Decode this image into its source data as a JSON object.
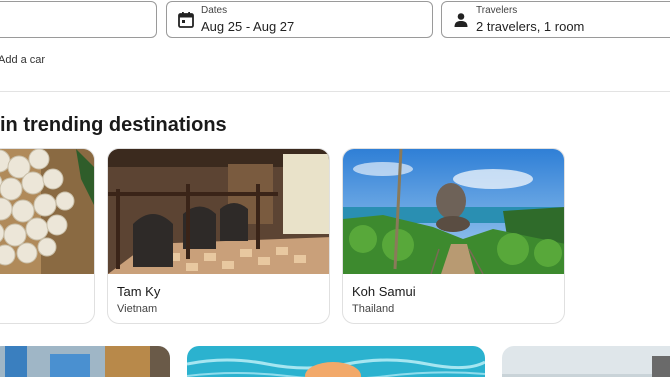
{
  "search": {
    "dates_label": "Dates",
    "dates_value": "Aug 25 - Aug 27",
    "travelers_label": "Travelers",
    "travelers_value": "2 travelers, 1 room",
    "add_car": "Add a car"
  },
  "section": {
    "heading": "in trending destinations"
  },
  "destinations": [
    {
      "name": "",
      "country": ""
    },
    {
      "name": "Tam Ky",
      "country": "Vietnam"
    },
    {
      "name": "Koh Samui",
      "country": "Thailand"
    }
  ],
  "icons": {
    "dates": "calendar-icon",
    "travelers": "person-icon"
  }
}
